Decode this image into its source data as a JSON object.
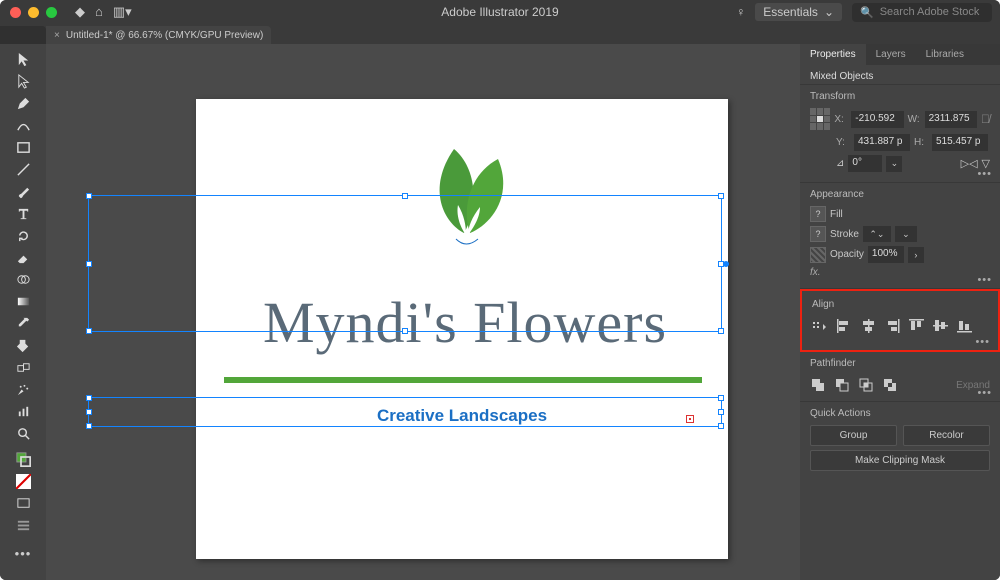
{
  "app": {
    "title": "Adobe Illustrator 2019",
    "workspace": "Essentials",
    "search_placeholder": "Search Adobe Stock"
  },
  "doc": {
    "tab_label": "Untitled-1* @ 66.67% (CMYK/GPU Preview)"
  },
  "canvas": {
    "heading": "Myndi's Flowers",
    "subheading": "Creative Landscapes"
  },
  "tools": [
    "selection",
    "direct-select",
    "pen",
    "curvature",
    "rect",
    "line",
    "brush",
    "type",
    "rotate",
    "scale",
    "eraser",
    "shape-builder",
    "gradient",
    "eyedropper",
    "live-paint",
    "artboard",
    "blend",
    "symbol",
    "graph",
    "slice",
    "zoom",
    "hand"
  ],
  "panel": {
    "tabs": [
      "Properties",
      "Layers",
      "Libraries"
    ],
    "active_tab": "Properties",
    "selection_label": "Mixed Objects",
    "transform": {
      "label": "Transform",
      "x": "-210.592",
      "y": "431.887 p",
      "w": "2311.875",
      "h": "515.457 p",
      "rotate": "0°"
    },
    "appearance": {
      "label": "Appearance",
      "fill_label": "Fill",
      "stroke_label": "Stroke",
      "opacity_label": "Opacity",
      "opacity_value": "100%",
      "fx_label": "fx."
    },
    "align": {
      "label": "Align"
    },
    "pathfinder": {
      "label": "Pathfinder",
      "expand": "Expand"
    },
    "quick": {
      "label": "Quick Actions",
      "group": "Group",
      "recolor": "Recolor",
      "mask": "Make Clipping Mask"
    }
  }
}
